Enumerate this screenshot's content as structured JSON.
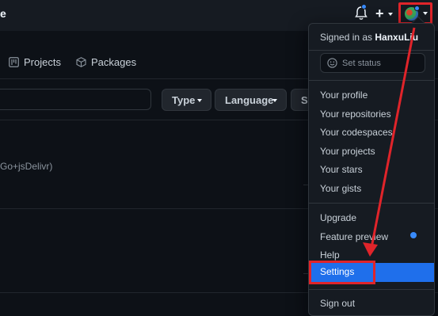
{
  "header": {
    "cut_text": "e"
  },
  "tabs": {
    "projects": "Projects",
    "packages": "Packages"
  },
  "filters": {
    "type": "Type",
    "language": "Language",
    "sort_cut": "So"
  },
  "repo": {
    "description_cut": "Go+jsDelivr)"
  },
  "menu": {
    "signed_in_prefix": "Signed in as",
    "username": "HanxuLiu",
    "set_status": "Set status",
    "items": [
      "Your profile",
      "Your repositories",
      "Your codespaces",
      "Your projects",
      "Your stars",
      "Your gists"
    ],
    "upgrade": "Upgrade",
    "feature_preview": "Feature preview",
    "help": "Help",
    "settings": "Settings",
    "sign_out": "Sign out"
  },
  "icons": {
    "bell": "bell-icon",
    "plus": "plus-icon",
    "avatar": "avatar",
    "projects": "project-board-icon",
    "packages": "package-icon",
    "status": "smiley-icon"
  },
  "colors": {
    "background": "#0d1117",
    "header": "#161b22",
    "accent": "#1f6feb",
    "notification": "#388bfd",
    "annotation": "#e0242a"
  }
}
